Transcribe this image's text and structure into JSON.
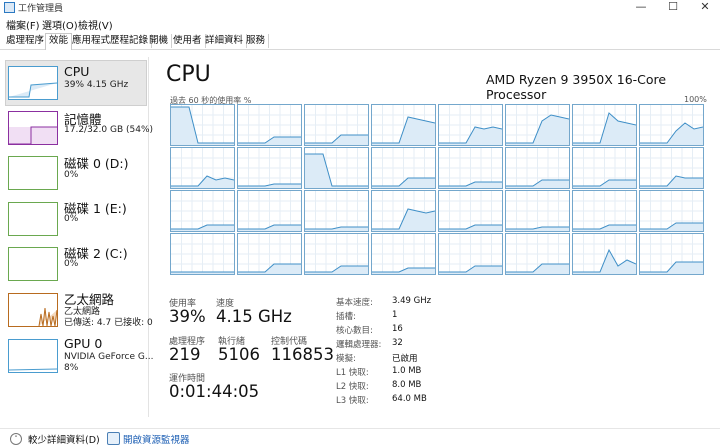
{
  "window": {
    "title": "工作管理員"
  },
  "menu": [
    "檔案(F)",
    "選項(O)",
    "檢視(V)"
  ],
  "tabs": [
    {
      "label": "處理程序",
      "active": false
    },
    {
      "label": "效能",
      "active": true
    },
    {
      "label": "應用程式歷程記錄",
      "active": false
    },
    {
      "label": "開機",
      "active": false
    },
    {
      "label": "使用者",
      "active": false
    },
    {
      "label": "詳細資料",
      "active": false
    },
    {
      "label": "服務",
      "active": false
    }
  ],
  "sidebar": {
    "items": [
      {
        "title": "CPU",
        "sub1": "39%  4.15 GHz",
        "sub2": "",
        "sub3": "",
        "color": "#4a9ccf"
      },
      {
        "title": "記憶體",
        "sub1": "17.2/32.0 GB (54%)",
        "sub2": "",
        "sub3": "",
        "color": "#8b2fa0"
      },
      {
        "title": "磁碟 0 (D:)",
        "sub1": "0%",
        "sub2": "",
        "sub3": "",
        "color": "#6aa84f"
      },
      {
        "title": "磁碟 1 (E:)",
        "sub1": "0%",
        "sub2": "",
        "sub3": "",
        "color": "#6aa84f"
      },
      {
        "title": "磁碟 2 (C:)",
        "sub1": "0%",
        "sub2": "",
        "sub3": "",
        "color": "#6aa84f"
      },
      {
        "title": "乙太網路",
        "sub1": "乙太網路",
        "sub2": "已傳送: 4.7  已接收: 0",
        "sub3": "",
        "color": "#b86b1f"
      },
      {
        "title": "GPU 0",
        "sub1": "NVIDIA GeForce G...",
        "sub2": "8%",
        "sub3": "",
        "color": "#4a9ccf"
      }
    ]
  },
  "main": {
    "title": "CPU",
    "model": "AMD Ryzen 9 3950X 16-Core Processor",
    "graph_label": "過去 60 秒的使用率 %",
    "graph_max": "100%",
    "stats": {
      "utilization_label": "使用率",
      "utilization": "39%",
      "speed_label": "速度",
      "speed": "4.15 GHz",
      "processes_label": "處理程序",
      "processes": "219",
      "threads_label": "執行緒",
      "threads": "5106",
      "handles_label": "控制代碼",
      "handles": "116853",
      "uptime_label": "運作時間",
      "uptime": "0:01:44:05"
    },
    "details": [
      {
        "label": "基本速度:",
        "value": "3.49 GHz"
      },
      {
        "label": "插槽:",
        "value": "1"
      },
      {
        "label": "核心數目:",
        "value": "16"
      },
      {
        "label": "邏輯處理器:",
        "value": "32"
      },
      {
        "label": "模擬:",
        "value": "已啟用"
      },
      {
        "label": "L1 快取:",
        "value": "1.0 MB"
      },
      {
        "label": "L2 快取:",
        "value": "8.0 MB"
      },
      {
        "label": "L3 快取:",
        "value": "64.0 MB"
      }
    ]
  },
  "footer": {
    "fewer_details": "較少詳細資料(D)",
    "resource_monitor": "開啟資源監視器"
  },
  "core_graphs": [
    [
      0.95,
      0.95,
      0.95,
      0.05,
      0.05,
      0.05,
      0.05,
      0.05
    ],
    [
      0.05,
      0.05,
      0.05,
      0.05,
      0.2,
      0.2,
      0.2,
      0.2
    ],
    [
      0.05,
      0.05,
      0.05,
      0.05,
      0.25,
      0.25,
      0.25,
      0.25
    ],
    [
      0.05,
      0.05,
      0.05,
      0.05,
      0.7,
      0.65,
      0.6,
      0.55
    ],
    [
      0.05,
      0.05,
      0.05,
      0.05,
      0.45,
      0.4,
      0.45,
      0.4
    ],
    [
      0.05,
      0.05,
      0.05,
      0.05,
      0.6,
      0.75,
      0.7,
      0.65
    ],
    [
      0.05,
      0.05,
      0.05,
      0.05,
      0.8,
      0.6,
      0.55,
      0.5
    ],
    [
      0.05,
      0.05,
      0.05,
      0.05,
      0.35,
      0.55,
      0.4,
      0.45
    ],
    [
      0.05,
      0.05,
      0.05,
      0.05,
      0.3,
      0.2,
      0.25,
      0.2
    ],
    [
      0.05,
      0.05,
      0.05,
      0.05,
      0.1,
      0.1,
      0.1,
      0.1
    ],
    [
      0.85,
      0.85,
      0.85,
      0.05,
      0.05,
      0.05,
      0.05,
      0.05
    ],
    [
      0.05,
      0.05,
      0.05,
      0.05,
      0.25,
      0.25,
      0.25,
      0.25
    ],
    [
      0.05,
      0.05,
      0.05,
      0.05,
      0.15,
      0.15,
      0.15,
      0.15
    ],
    [
      0.05,
      0.05,
      0.05,
      0.05,
      0.2,
      0.2,
      0.2,
      0.2
    ],
    [
      0.05,
      0.05,
      0.05,
      0.05,
      0.2,
      0.2,
      0.2,
      0.2
    ],
    [
      0.05,
      0.05,
      0.05,
      0.05,
      0.3,
      0.25,
      0.25,
      0.25
    ],
    [
      0.05,
      0.05,
      0.05,
      0.05,
      0.15,
      0.15,
      0.15,
      0.15
    ],
    [
      0.05,
      0.05,
      0.05,
      0.05,
      0.15,
      0.15,
      0.15,
      0.15
    ],
    [
      0.05,
      0.05,
      0.05,
      0.05,
      0.1,
      0.1,
      0.1,
      0.1
    ],
    [
      0.05,
      0.05,
      0.05,
      0.05,
      0.55,
      0.5,
      0.45,
      0.5
    ],
    [
      0.05,
      0.05,
      0.05,
      0.05,
      0.15,
      0.15,
      0.15,
      0.15
    ],
    [
      0.05,
      0.05,
      0.05,
      0.05,
      0.1,
      0.1,
      0.1,
      0.1
    ],
    [
      0.05,
      0.05,
      0.05,
      0.05,
      0.15,
      0.15,
      0.15,
      0.15
    ],
    [
      0.05,
      0.05,
      0.05,
      0.05,
      0.2,
      0.2,
      0.2,
      0.2
    ],
    [
      0.05,
      0.05,
      0.05,
      0.05,
      0.05,
      0.05,
      0.05,
      0.05
    ],
    [
      0.05,
      0.05,
      0.05,
      0.05,
      0.25,
      0.25,
      0.25,
      0.25
    ],
    [
      0.05,
      0.05,
      0.05,
      0.05,
      0.2,
      0.2,
      0.2,
      0.2
    ],
    [
      0.05,
      0.05,
      0.05,
      0.05,
      0.15,
      0.15,
      0.15,
      0.15
    ],
    [
      0.05,
      0.05,
      0.05,
      0.05,
      0.2,
      0.2,
      0.2,
      0.2
    ],
    [
      0.05,
      0.05,
      0.05,
      0.05,
      0.25,
      0.25,
      0.25,
      0.25
    ],
    [
      0.05,
      0.05,
      0.05,
      0.05,
      0.6,
      0.2,
      0.35,
      0.25
    ],
    [
      0.05,
      0.05,
      0.05,
      0.05,
      0.3,
      0.3,
      0.3,
      0.3
    ]
  ]
}
